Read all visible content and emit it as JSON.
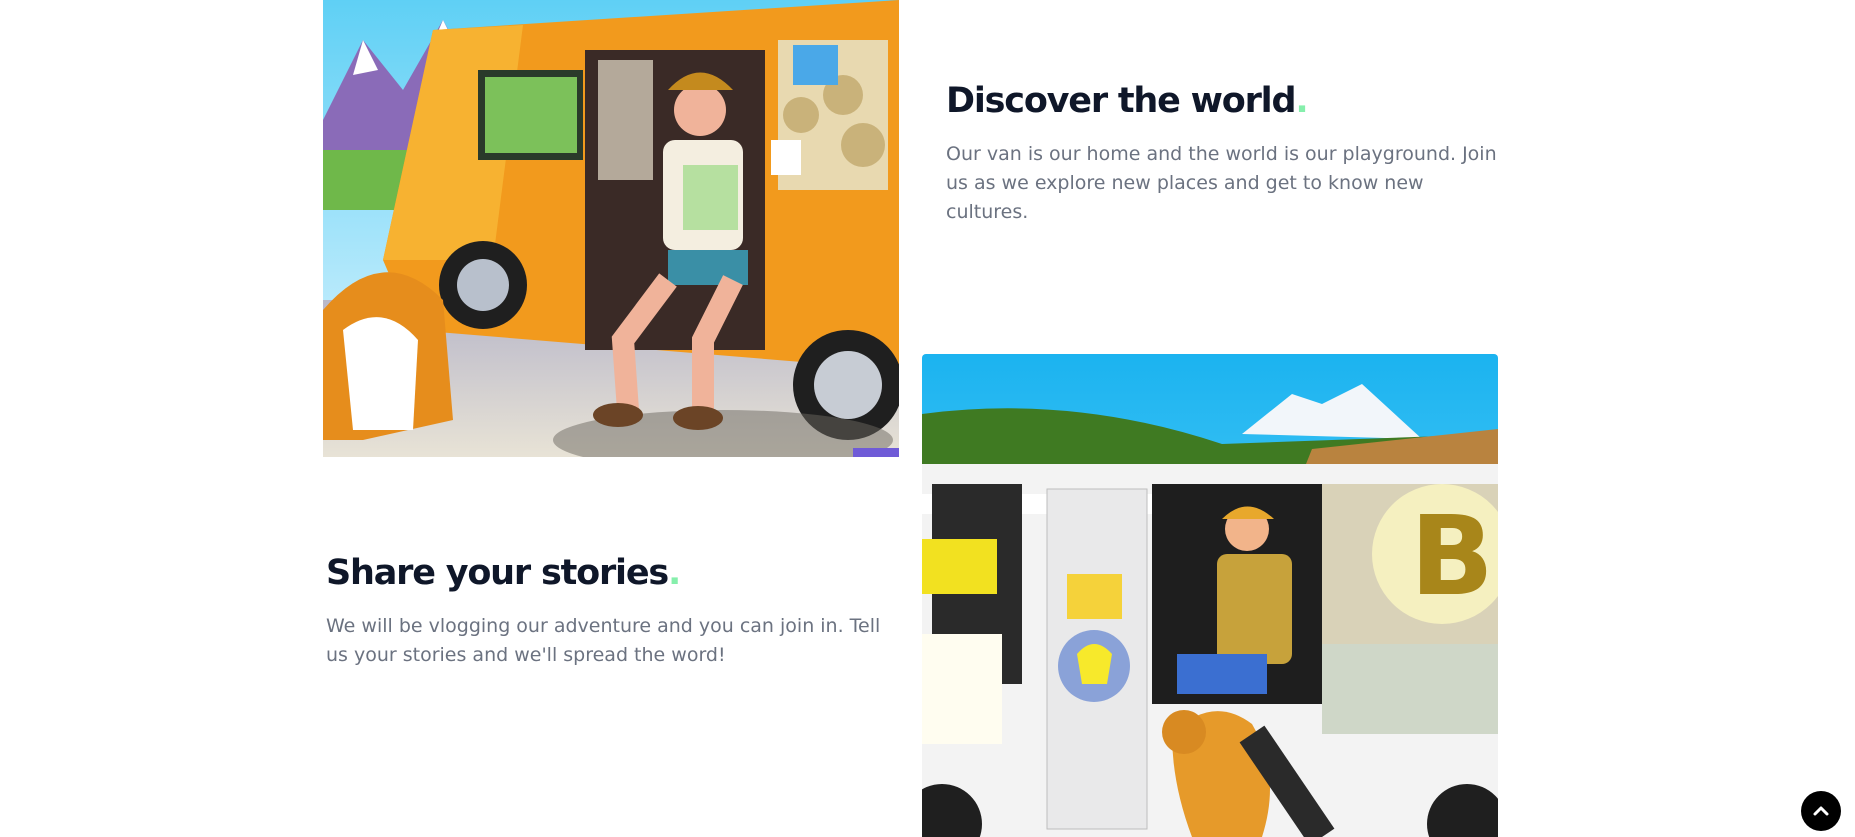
{
  "sections": [
    {
      "title": "Discover the world",
      "title_punct": ".",
      "body": "Our van is our home and the world is our playground. Join us as we explore new places and get to know new cultures."
    },
    {
      "title": "Share your stories",
      "title_punct": ".",
      "body": "We will be vlogging our adventure and you can join in. Tell us your stories and we'll spread the word!"
    }
  ],
  "images": [
    {
      "icon": "man-in-orange-van-illustration"
    },
    {
      "icon": "man-in-white-van-illustration"
    }
  ],
  "scroll_top": {
    "icon": "chevron-up-icon"
  },
  "colors": {
    "heading": "#0f1729",
    "accent_dot": "#86efac",
    "body_text": "#6b7280",
    "background": "#ffffff",
    "scroll_button": "#000000"
  }
}
